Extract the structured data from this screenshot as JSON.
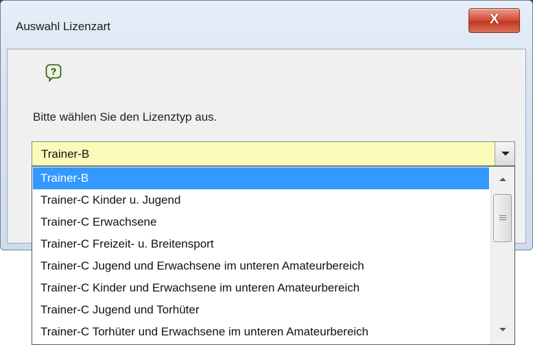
{
  "dialog": {
    "title": "Auswahl Lizenzart",
    "close_glyph": "X",
    "prompt": "Bitte wählen Sie den Lizenztyp aus.",
    "icon": "question-bubble-icon",
    "accent_color": "#3399ff",
    "combo_background": "#fbfab9"
  },
  "license_combo": {
    "selected_value": "Trainer-B",
    "options": [
      "Trainer-B",
      "Trainer-C Kinder u. Jugend",
      "Trainer-C Erwachsene",
      "Trainer-C Freizeit- u. Breitensport",
      "Trainer-C Jugend und Erwachsene im unteren Amateurbereich",
      "Trainer-C Kinder und Erwachsene im unteren Amateurbereich",
      "Trainer-C Jugend und Torhüter",
      "Trainer-C Torhüter und Erwachsene im unteren Amateurbereich"
    ],
    "highlighted_index": 0
  }
}
